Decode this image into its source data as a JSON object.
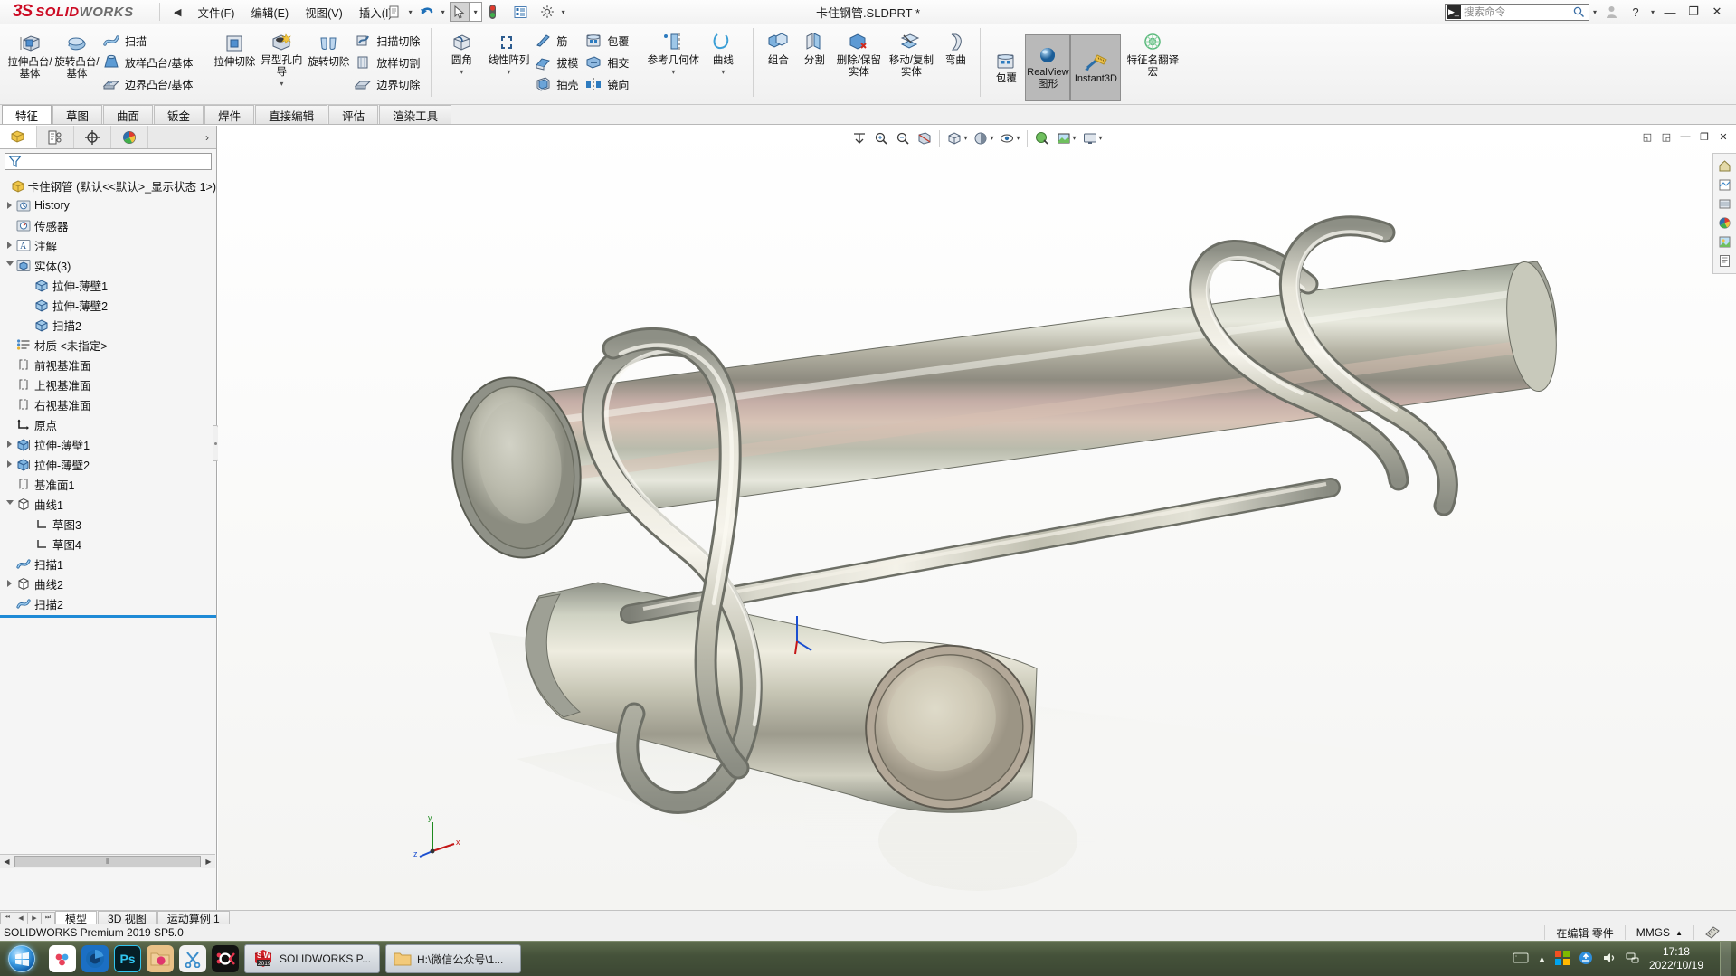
{
  "app": {
    "brand_ds": "3S",
    "brand_solid": "SOLID",
    "brand_works": "WORKS",
    "document_title": "卡住钢管.SLDPRT *",
    "version_status": "SOLIDWORKS Premium 2019 SP5.0"
  },
  "menu": {
    "collapse_arrow": "◀",
    "items": [
      {
        "label": "文件(F)",
        "name": "menu-file"
      },
      {
        "label": "编辑(E)",
        "name": "menu-edit"
      },
      {
        "label": "视图(V)",
        "name": "menu-view"
      },
      {
        "label": "插入(I)",
        "name": "menu-insert"
      }
    ],
    "quick_tools": [
      {
        "name": "undo-icon",
        "glyph": "↶"
      },
      {
        "name": "select-cursor-icon",
        "glyph": "▱"
      },
      {
        "name": "rebuild-icon",
        "glyph": "●"
      },
      {
        "name": "options-list-icon",
        "glyph": "▤"
      },
      {
        "name": "gear-icon",
        "glyph": "⚙"
      }
    ]
  },
  "search": {
    "placeholder": "搜索命令",
    "icon": "search-icon"
  },
  "window_controls": {
    "account": "👤",
    "help": "?",
    "minimize": "—",
    "restore": "❐",
    "close": "✕"
  },
  "ribbon": {
    "groups": [
      {
        "name": "boss-base-group",
        "big": [
          {
            "label": "拉伸凸台/基体",
            "name": "extruded-boss-base",
            "icon": "extrude-icon"
          },
          {
            "label": "旋转凸台/基体",
            "name": "revolved-boss-base",
            "icon": "revolve-icon"
          }
        ],
        "small": [
          {
            "label": "扫描",
            "name": "swept-boss-base",
            "icon": "sweep-icon"
          },
          {
            "label": "放样凸台/基体",
            "name": "lofted-boss-base",
            "icon": "loft-icon"
          },
          {
            "label": "边界凸台/基体",
            "name": "boundary-boss-base",
            "icon": "boundary-icon"
          }
        ]
      },
      {
        "name": "cut-group",
        "big": [
          {
            "label": "拉伸切除",
            "name": "extruded-cut",
            "icon": "extrude-cut-icon"
          },
          {
            "label": "异型孔向导",
            "name": "hole-wizard",
            "icon": "hole-wizard-icon",
            "dropdown": true
          },
          {
            "label": "旋转切除",
            "name": "revolved-cut",
            "icon": "revolve-cut-icon"
          }
        ],
        "small": [
          {
            "label": "扫描切除",
            "name": "swept-cut",
            "icon": "sweep-cut-icon"
          },
          {
            "label": "放样切割",
            "name": "lofted-cut",
            "icon": "loft-cut-icon"
          },
          {
            "label": "边界切除",
            "name": "boundary-cut",
            "icon": "boundary-cut-icon"
          }
        ]
      },
      {
        "name": "feature-group",
        "big": [
          {
            "label": "圆角",
            "name": "fillet",
            "icon": "fillet-icon",
            "dropdown": true
          },
          {
            "label": "线性阵列",
            "name": "linear-pattern",
            "icon": "linear-pattern-icon",
            "dropdown": true
          }
        ],
        "small": [
          {
            "label": "筋",
            "name": "rib",
            "icon": "rib-icon"
          },
          {
            "label": "拔模",
            "name": "draft",
            "icon": "draft-icon"
          },
          {
            "label": "抽壳",
            "name": "shell",
            "icon": "shell-icon"
          }
        ],
        "small2": [
          {
            "label": "包覆",
            "name": "wrap",
            "icon": "wrap-icon"
          },
          {
            "label": "相交",
            "name": "intersect",
            "icon": "intersect-icon"
          },
          {
            "label": "镜向",
            "name": "mirror",
            "icon": "mirror-icon"
          }
        ]
      },
      {
        "name": "reference-group",
        "big": [
          {
            "label": "参考几何体",
            "name": "reference-geometry",
            "icon": "reference-geometry-icon",
            "dropdown": true
          },
          {
            "label": "曲线",
            "name": "curves",
            "icon": "curves-icon",
            "dropdown": true
          }
        ]
      },
      {
        "name": "bodies-group",
        "big": [
          {
            "label": "组合",
            "name": "combine",
            "icon": "combine-icon"
          },
          {
            "label": "分割",
            "name": "split",
            "icon": "split-icon"
          },
          {
            "label": "删除/保留实体",
            "name": "delete-keep-body",
            "icon": "delete-body-icon"
          },
          {
            "label": "移动/复制实体",
            "name": "move-copy-body",
            "icon": "move-copy-icon"
          },
          {
            "label": "弯曲",
            "name": "flex",
            "icon": "flex-icon"
          }
        ]
      },
      {
        "name": "display-group",
        "big": [
          {
            "label": "包覆",
            "name": "wrap-2",
            "icon": "wrap-icon"
          }
        ],
        "toggles": [
          {
            "label": "RealView 图形",
            "name": "realview-graphics",
            "active": true,
            "icon": "realview-icon"
          },
          {
            "label": "Instant3D",
            "name": "instant3d",
            "active": true,
            "icon": "instant3d-icon"
          }
        ]
      },
      {
        "name": "macro-group",
        "big": [
          {
            "label": "特征名翻译宏",
            "name": "feature-name-translate-macro",
            "icon": "macro-icon"
          }
        ]
      }
    ]
  },
  "command_tabs": [
    {
      "label": "特征",
      "name": "tab-features",
      "active": true
    },
    {
      "label": "草图",
      "name": "tab-sketch",
      "active": false
    },
    {
      "label": "曲面",
      "name": "tab-surfaces",
      "active": false
    },
    {
      "label": "钣金",
      "name": "tab-sheet-metal",
      "active": false
    },
    {
      "label": "焊件",
      "name": "tab-weldments",
      "active": false
    },
    {
      "label": "直接编辑",
      "name": "tab-direct-editing",
      "active": false
    },
    {
      "label": "评估",
      "name": "tab-evaluate",
      "active": false
    },
    {
      "label": "渲染工具",
      "name": "tab-render-tools",
      "active": false
    }
  ],
  "tree_panel": {
    "tabs": [
      {
        "name": "feature-manager-tab",
        "icon": "feature-tree-icon",
        "active": true
      },
      {
        "name": "property-manager-tab",
        "icon": "property-manager-icon",
        "active": false
      },
      {
        "name": "configuration-manager-tab",
        "icon": "configuration-icon",
        "active": false
      },
      {
        "name": "display-manager-tab",
        "icon": "display-manager-icon",
        "active": false
      }
    ],
    "more_arrow": "›",
    "filter_placeholder": "",
    "root": "卡住钢管  (默认<<默认>_显示状态 1>)",
    "items": [
      {
        "label": "History",
        "indent": 1,
        "twist": "closed",
        "icon": "history-icon",
        "name": "tree-item-history"
      },
      {
        "label": "传感器",
        "indent": 1,
        "twist": "none",
        "icon": "sensor-icon",
        "name": "tree-item-sensors"
      },
      {
        "label": "注解",
        "indent": 1,
        "twist": "closed",
        "icon": "annotation-icon",
        "name": "tree-item-annotations"
      },
      {
        "label": "实体(3)",
        "indent": 1,
        "twist": "open",
        "icon": "solid-bodies-icon",
        "name": "tree-item-solid-bodies"
      },
      {
        "label": "拉伸-薄壁1",
        "indent": 2,
        "twist": "none",
        "icon": "body-icon",
        "name": "tree-item-extrude-thin1-body"
      },
      {
        "label": "拉伸-薄壁2",
        "indent": 2,
        "twist": "none",
        "icon": "body-icon",
        "name": "tree-item-extrude-thin2-body"
      },
      {
        "label": "扫描2",
        "indent": 2,
        "twist": "none",
        "icon": "body-icon",
        "name": "tree-item-sweep2-body"
      },
      {
        "label": "材质 <未指定>",
        "indent": 1,
        "twist": "none",
        "icon": "material-icon",
        "name": "tree-item-material"
      },
      {
        "label": "前视基准面",
        "indent": 1,
        "twist": "none",
        "icon": "plane-icon",
        "name": "tree-item-front-plane"
      },
      {
        "label": "上视基准面",
        "indent": 1,
        "twist": "none",
        "icon": "plane-icon",
        "name": "tree-item-top-plane"
      },
      {
        "label": "右视基准面",
        "indent": 1,
        "twist": "none",
        "icon": "plane-icon",
        "name": "tree-item-right-plane"
      },
      {
        "label": "原点",
        "indent": 1,
        "twist": "none",
        "icon": "origin-icon",
        "name": "tree-item-origin"
      },
      {
        "label": "拉伸-薄壁1",
        "indent": 1,
        "twist": "closed",
        "icon": "extrude-feature-icon",
        "name": "tree-item-extrude-thin1"
      },
      {
        "label": "拉伸-薄壁2",
        "indent": 1,
        "twist": "closed",
        "icon": "extrude-feature-icon",
        "name": "tree-item-extrude-thin2"
      },
      {
        "label": "基准面1",
        "indent": 1,
        "twist": "none",
        "icon": "plane-icon",
        "name": "tree-item-plane1"
      },
      {
        "label": "曲线1",
        "indent": 1,
        "twist": "open",
        "icon": "curve-icon",
        "name": "tree-item-curve1"
      },
      {
        "label": "草图3",
        "indent": 2,
        "twist": "none",
        "icon": "sketch-icon",
        "name": "tree-item-sketch3"
      },
      {
        "label": "草图4",
        "indent": 2,
        "twist": "none",
        "icon": "sketch-icon",
        "name": "tree-item-sketch4"
      },
      {
        "label": "扫描1",
        "indent": 1,
        "twist": "none",
        "icon": "sweep-feature-icon",
        "name": "tree-item-sweep1"
      },
      {
        "label": "曲线2",
        "indent": 1,
        "twist": "closed",
        "icon": "curve-icon",
        "name": "tree-item-curve2"
      },
      {
        "label": "扫描2",
        "indent": 1,
        "twist": "none",
        "icon": "sweep-feature-icon",
        "name": "tree-item-sweep2"
      }
    ],
    "rollback_bar_color": "#1e8ad6",
    "hscroll": {
      "left_arrow": "◀",
      "right_arrow": "▶",
      "grip": "⦀"
    }
  },
  "view_toolbar": {
    "buttons": [
      {
        "name": "zoom-to-fit-icon",
        "glyph": "⊥"
      },
      {
        "name": "zoom-to-area-icon",
        "glyph": "🔍"
      },
      {
        "name": "previous-view-icon",
        "glyph": "🔎"
      },
      {
        "name": "section-view-icon",
        "glyph": "◧"
      },
      {
        "name": "view-orientation-icon",
        "glyph": "◩"
      },
      {
        "name": "display-style-icon",
        "glyph": "◐"
      },
      {
        "name": "hide-show-items-icon",
        "glyph": "◇"
      },
      {
        "name": "edit-appearance-icon",
        "glyph": "◆"
      },
      {
        "name": "apply-scene-icon",
        "glyph": "◍"
      },
      {
        "name": "view-settings-icon",
        "glyph": "▣"
      }
    ],
    "window_buttons": [
      {
        "name": "tile-left-icon",
        "glyph": "◱"
      },
      {
        "name": "tile-right-icon",
        "glyph": "◲"
      },
      {
        "name": "minimize-doc-icon",
        "glyph": "—"
      },
      {
        "name": "restore-doc-icon",
        "glyph": "❐"
      },
      {
        "name": "close-doc-icon",
        "glyph": "✕"
      }
    ]
  },
  "right_rail": {
    "buttons": [
      {
        "name": "home-icon",
        "glyph": "⌂"
      },
      {
        "name": "appearances-icon",
        "glyph": "▦"
      },
      {
        "name": "scenes-icon",
        "glyph": "▤"
      },
      {
        "name": "color-swatch-icon",
        "glyph": "◕"
      },
      {
        "name": "decals-icon",
        "glyph": "▥"
      },
      {
        "name": "custom-properties-icon",
        "glyph": "▣"
      }
    ]
  },
  "triad": {
    "x_label": "x",
    "y_label": "y",
    "z_label": "z"
  },
  "doc_tabs": {
    "nav": [
      "⏮",
      "◀",
      "▶",
      "⏭"
    ],
    "tabs": [
      {
        "label": "模型",
        "name": "doc-tab-model",
        "active": true
      },
      {
        "label": "3D 视图",
        "name": "doc-tab-3dviews",
        "active": false
      },
      {
        "label": "运动算例 1",
        "name": "doc-tab-motion-study",
        "active": false
      }
    ]
  },
  "statusbar": {
    "left": "SOLIDWORKS Premium 2019 SP5.0",
    "editing": "在编辑 零件",
    "units": "MMGS",
    "units_caret": "▲",
    "overlay_icon": "📐"
  },
  "taskbar": {
    "start": "start-orb",
    "quick_icons": [
      {
        "name": "taskbar-icon-360cloud",
        "glyph": "∞",
        "bg": "#ffffff",
        "fg": "#e8425a"
      },
      {
        "name": "taskbar-icon-keyshot",
        "glyph": "◎",
        "bg": "#1b6fc4",
        "fg": "#ffffff"
      },
      {
        "name": "taskbar-icon-photoshop",
        "glyph": "Ps",
        "bg": "#061e26",
        "fg": "#31c5f0"
      },
      {
        "name": "taskbar-icon-picture-folder",
        "glyph": "🖼",
        "bg": "#e9c187",
        "fg": "#d6376e"
      },
      {
        "name": "taskbar-icon-snip",
        "glyph": "✂",
        "bg": "#f2f2f2",
        "fg": "#2f7fc1"
      },
      {
        "name": "taskbar-icon-okr",
        "glyph": "O",
        "bg": "#111111",
        "fg": "#e8344e"
      }
    ],
    "tasks": [
      {
        "label": "SOLIDWORKS P...",
        "name": "taskbar-task-solidworks",
        "icon": "solidworks-icon",
        "badge": "2019"
      },
      {
        "label": "H:\\微信公众号\\1...",
        "name": "taskbar-task-folder",
        "icon": "folder-icon"
      }
    ],
    "tray": [
      {
        "name": "tray-keyboard-icon",
        "glyph": "⌨"
      },
      {
        "name": "tray-expand-icon",
        "glyph": "▲"
      },
      {
        "name": "tray-windows-icon",
        "glyph": "⊞"
      },
      {
        "name": "tray-update-icon",
        "glyph": "⟳"
      },
      {
        "name": "tray-volume-icon",
        "glyph": "🔊"
      },
      {
        "name": "tray-network-icon",
        "glyph": "🖧"
      }
    ],
    "clock_time": "17:18",
    "clock_date": "2022/10/19"
  }
}
